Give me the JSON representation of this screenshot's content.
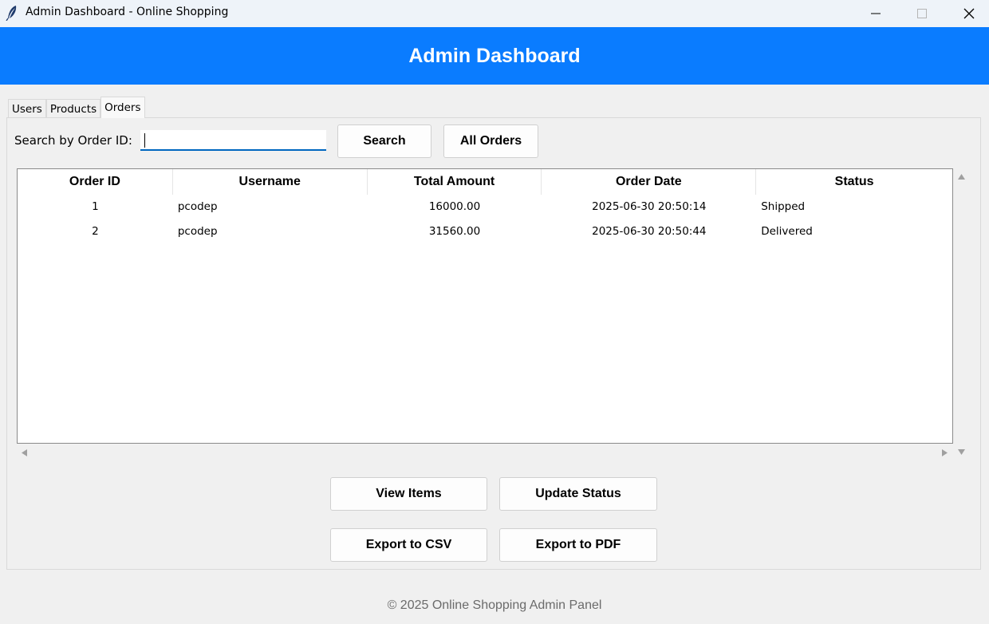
{
  "window": {
    "title": "Admin Dashboard - Online Shopping",
    "app_icon": "feather-icon",
    "controls": [
      "minimize-icon",
      "maximize-icon",
      "close-icon"
    ]
  },
  "header": {
    "title": "Admin Dashboard",
    "background": "#0a7cff"
  },
  "tabs": [
    {
      "label": "Users",
      "active": false
    },
    {
      "label": "Products",
      "active": false
    },
    {
      "label": "Orders",
      "active": true
    }
  ],
  "search": {
    "label": "Search by Order ID:",
    "value": ""
  },
  "buttons": {
    "search": "Search",
    "all_orders": "All Orders",
    "view_items": "View Items",
    "update_status": "Update Status",
    "export_csv": "Export to CSV",
    "export_pdf": "Export to PDF"
  },
  "table": {
    "columns": [
      "Order ID",
      "Username",
      "Total Amount",
      "Order Date",
      "Status"
    ],
    "rows": [
      [
        "1",
        "pcodep",
        "16000.00",
        "2025-06-30 20:50:14",
        "Shipped"
      ],
      [
        "2",
        "pcodep",
        "31560.00",
        "2025-06-30 20:50:44",
        "Delivered"
      ]
    ]
  },
  "footer": {
    "text": "© 2025 Online Shopping Admin Panel"
  }
}
